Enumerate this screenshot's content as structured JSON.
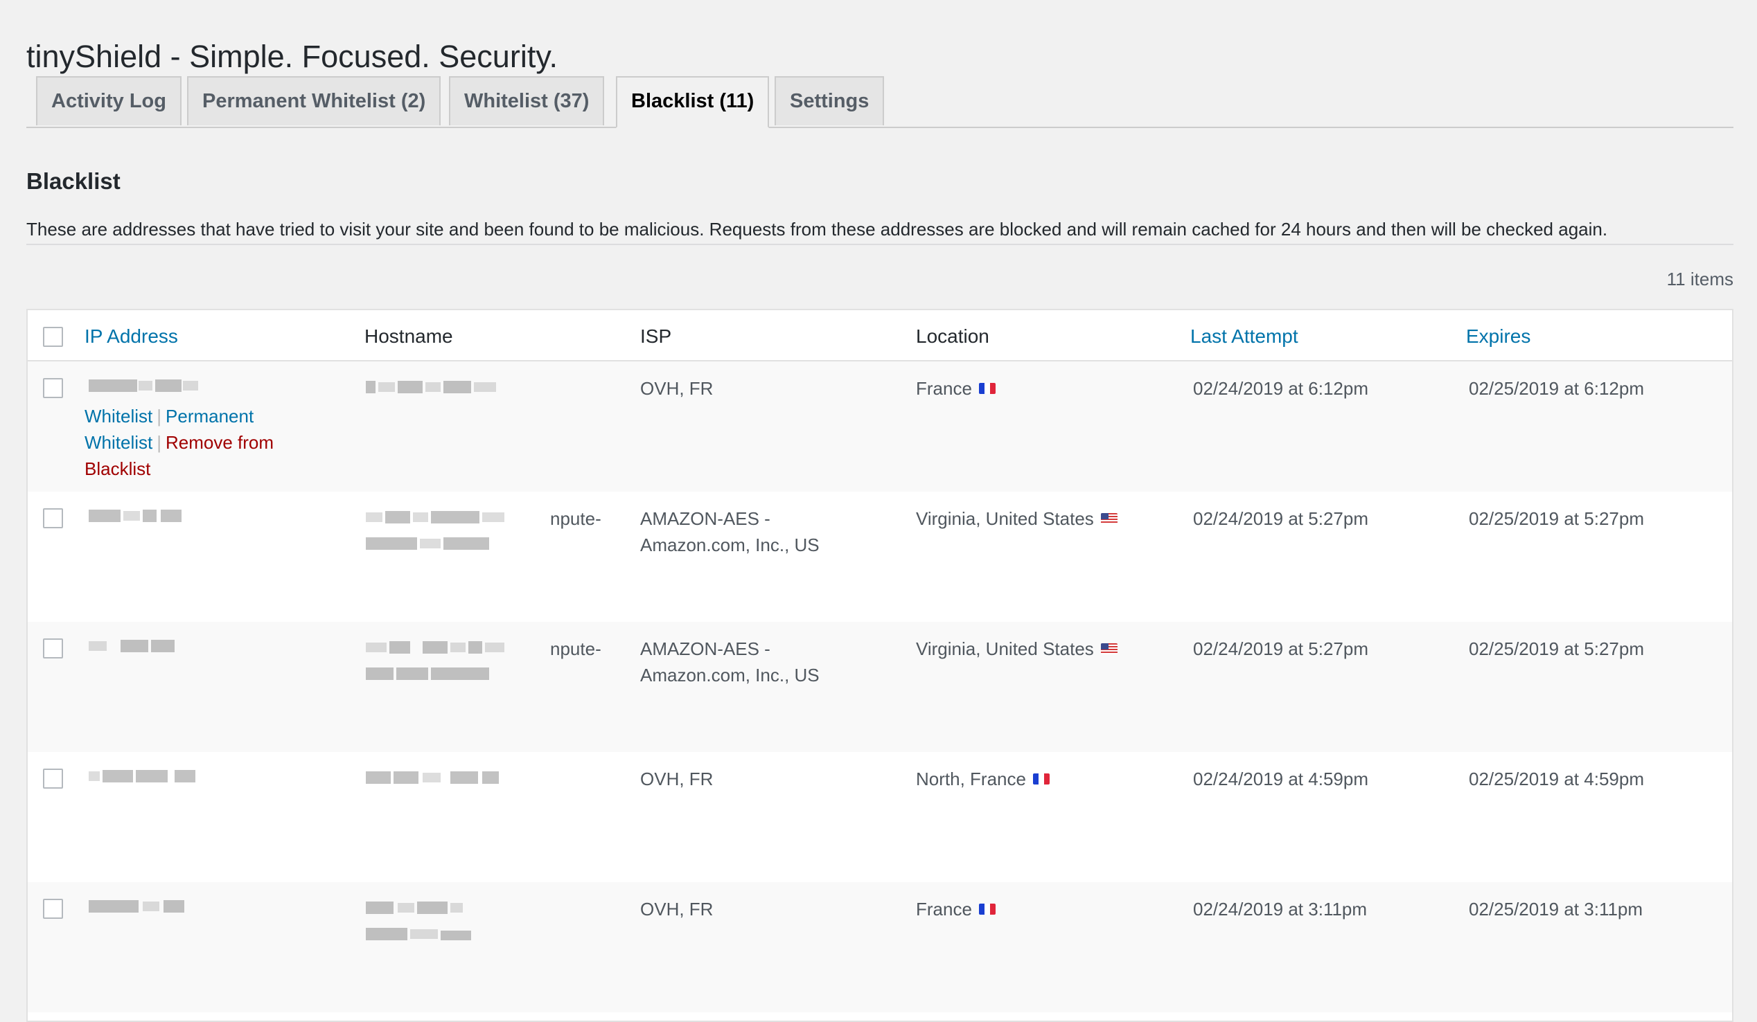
{
  "page": {
    "title": "tinyShield - Simple. Focused. Security."
  },
  "tabs": [
    {
      "label": "Activity Log",
      "active": false
    },
    {
      "label": "Permanent Whitelist (2)",
      "active": false
    },
    {
      "label": "Whitelist (37)",
      "active": false
    },
    {
      "label": "Blacklist (11)",
      "active": true
    },
    {
      "label": "Settings",
      "active": false
    }
  ],
  "section": {
    "title": "Blacklist",
    "description": "These are addresses that have tried to visit your site and been found to be malicious. Requests from these addresses are blocked and will remain cached for 24 hours and then will be checked again.",
    "items_count": "11 items"
  },
  "table": {
    "columns": {
      "ip": "IP Address",
      "hostname": "Hostname",
      "isp": "ISP",
      "location": "Location",
      "last_attempt": "Last Attempt",
      "expires": "Expires"
    },
    "row_actions": {
      "whitelist": "Whitelist",
      "permanent_whitelist": "Permanent Whitelist",
      "remove": "Remove from Blacklist",
      "separator": "|"
    },
    "rows": [
      {
        "hostname_suffix": "",
        "isp": "OVH, FR",
        "location": "France",
        "flag": "flag-fr",
        "last_attempt": "02/24/2019 at 6:12pm",
        "expires": "02/25/2019 at 6:12pm"
      },
      {
        "hostname_suffix": "npute-",
        "isp": "AMAZON-AES - Amazon.com, Inc., US",
        "location": "Virginia, United States",
        "flag": "flag-us",
        "last_attempt": "02/24/2019 at 5:27pm",
        "expires": "02/25/2019 at 5:27pm"
      },
      {
        "hostname_suffix": "npute-",
        "isp": "AMAZON-AES - Amazon.com, Inc., US",
        "location": "Virginia, United States",
        "flag": "flag-us",
        "last_attempt": "02/24/2019 at 5:27pm",
        "expires": "02/25/2019 at 5:27pm"
      },
      {
        "hostname_suffix": "",
        "isp": "OVH, FR",
        "location": "North, France",
        "flag": "flag-fr",
        "last_attempt": "02/24/2019 at 4:59pm",
        "expires": "02/25/2019 at 4:59pm"
      },
      {
        "hostname_suffix": "",
        "isp": "OVH, FR",
        "location": "France",
        "flag": "flag-fr",
        "last_attempt": "02/24/2019 at 3:11pm",
        "expires": "02/25/2019 at 3:11pm"
      }
    ]
  },
  "colors": {
    "link": "#0073aa",
    "danger": "#a00000",
    "background": "#f1f1f1",
    "text": "#23282d"
  }
}
